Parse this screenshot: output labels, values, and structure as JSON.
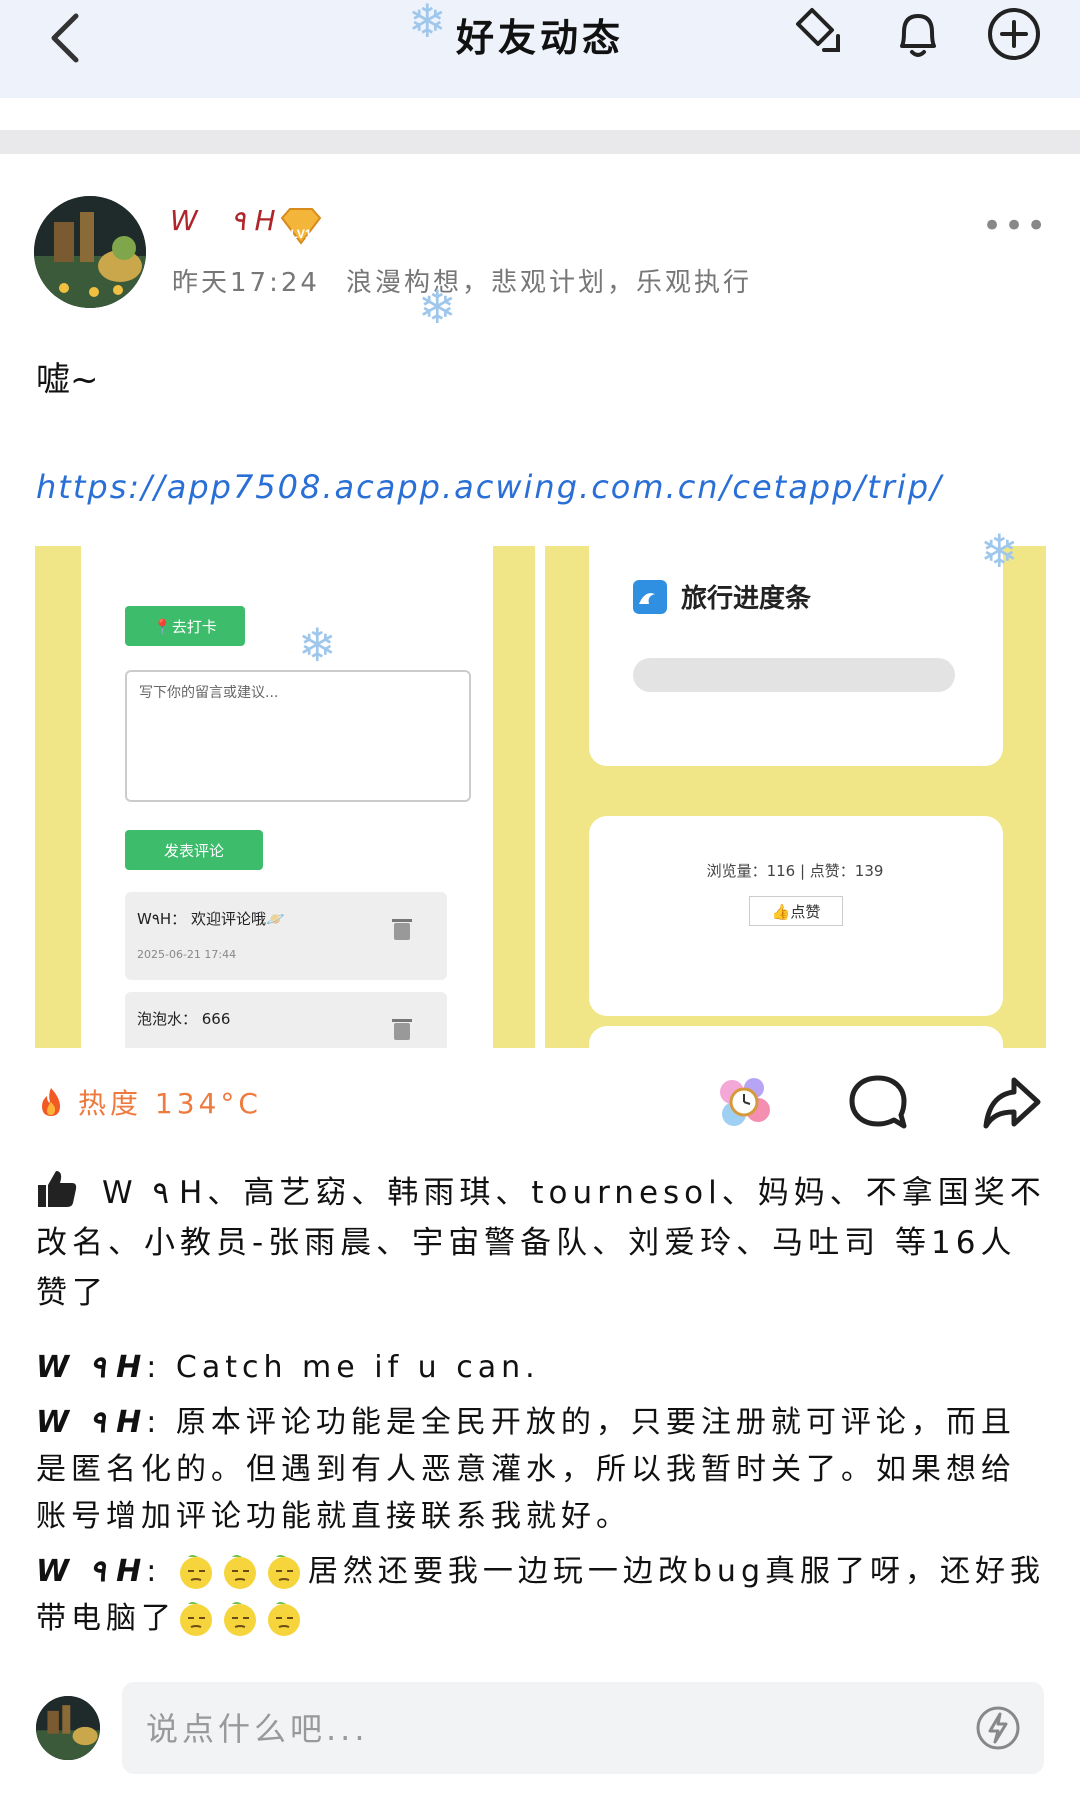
{
  "header": {
    "title": "好友动态"
  },
  "post": {
    "username": "W ٩ H",
    "level": "LV1",
    "time": "昨天17:24",
    "signature": "浪漫构想，悲观计划，乐观执行",
    "text": "嘘~",
    "link": "https://app7508.acapp.acwing.com.cn/cetapp/trip/"
  },
  "screenshot": {
    "checkin_label": "📍去打卡",
    "textarea_placeholder": "写下你的留言或建议...",
    "submit_label": "发表评论",
    "comments": [
      {
        "who": "W٩H： 欢迎评论哦🪐",
        "time": "2025-06-21 17:44"
      },
      {
        "who": "泡泡水： 666",
        "time": ""
      }
    ],
    "progress_title": "旅行进度条",
    "stats": "浏览量：116 | 点赞：139",
    "like_label": "👍点赞"
  },
  "heat": {
    "label": "热度 134°C"
  },
  "likes": {
    "text": "W ٩ H、高艺窈、韩雨琪、tournesol、妈妈、不拿国奖不改名、小教员-张雨晨、宇宙警备队、刘爱玲、马吐司 等16人赞了"
  },
  "comments": [
    {
      "author": "W ٩ H",
      "text": "Catch me if u can."
    },
    {
      "author": "W ٩ H",
      "text": "原本评论功能是全民开放的，只要注册就可评论，而且是匿名化的。但遇到有人恶意灌水，所以我暂时关了。如果想给账号增加评论功能就直接联系我就好。"
    },
    {
      "author": "W ٩ H",
      "text_a": "居然还要我一边玩一边改bug真服了呀，还好我带电脑了"
    }
  ],
  "input": {
    "placeholder": "说点什么吧..."
  },
  "colors": {
    "accent_blue": "#2a6fd6",
    "heat_orange": "#ee7a3e",
    "username_red": "#b0252a",
    "screenshot_yellow": "#f0e587",
    "green_button": "#3dbd6c"
  },
  "icons": [
    "back-icon",
    "diamond-edit-icon",
    "bell-icon",
    "add-circle-icon",
    "more-icon",
    "flame-icon",
    "decor-sticker-icon",
    "comment-icon",
    "share-icon",
    "thumb-up-icon",
    "emoji-icon",
    "lightning-icon"
  ]
}
